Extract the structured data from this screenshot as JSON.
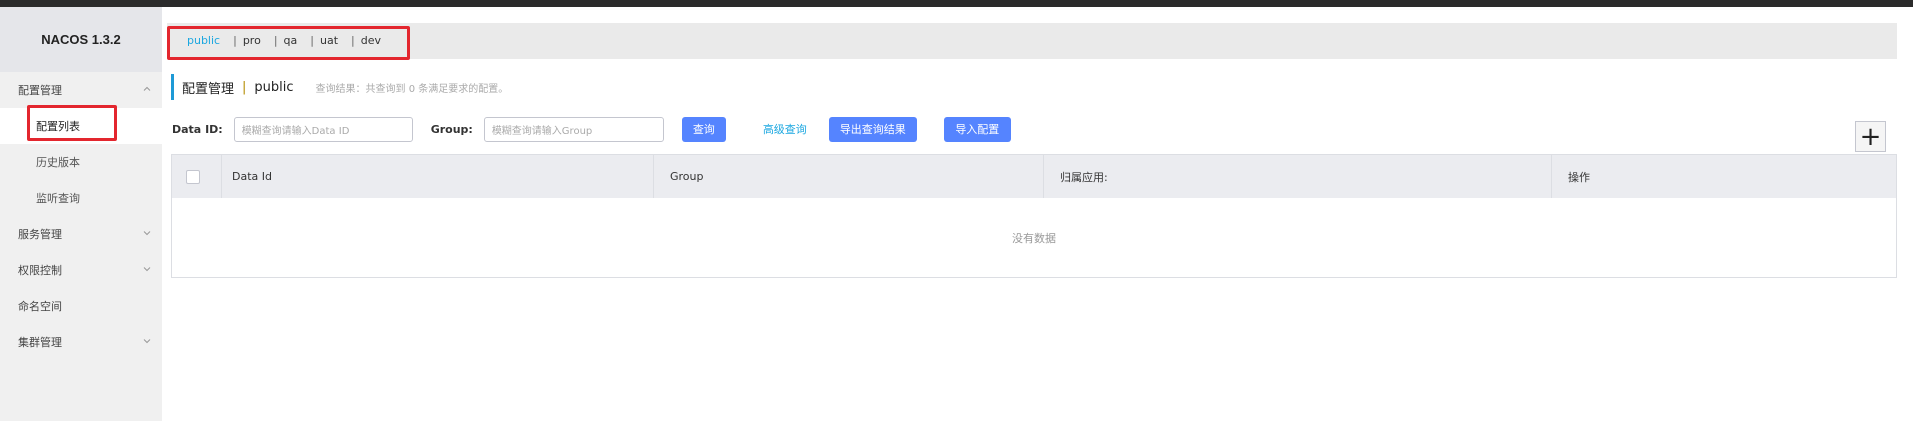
{
  "app": {
    "logo": "NACOS 1.3.2"
  },
  "sidebar": {
    "groups": [
      {
        "label": "配置管理",
        "chevron": "chevron-up-icon",
        "children": [
          "配置列表",
          "历史版本",
          "监听查询"
        ]
      },
      {
        "label": "服务管理",
        "chevron": "chevron-down-icon"
      },
      {
        "label": "权限控制",
        "chevron": "chevron-down-icon"
      },
      {
        "label": "命名空间"
      },
      {
        "label": "集群管理",
        "chevron": "chevron-down-icon"
      }
    ],
    "active_item": "配置列表"
  },
  "namespaces": {
    "items": [
      "public",
      "pro",
      "qa",
      "uat",
      "dev"
    ],
    "separator": "|",
    "active": "public"
  },
  "header": {
    "title": "配置管理",
    "separator": "|",
    "namespace": "public",
    "result_text": "查询结果：共查询到 0 条满足要求的配置。"
  },
  "search": {
    "data_id_label": "Data ID:",
    "data_id_placeholder": "模糊查询请输入Data ID",
    "group_label": "Group:",
    "group_placeholder": "模糊查询请输入Group",
    "query_button": "查询",
    "advanced_query": "高级查询",
    "export_button": "导出查询结果",
    "import_button": "导入配置"
  },
  "add_button": "+",
  "table": {
    "columns": [
      "Data Id",
      "Group",
      "归属应用:",
      "操作"
    ],
    "empty_text": "没有数据"
  },
  "colors": {
    "accent": "#1ba7e0",
    "primary_button": "#5584ff",
    "highlight_box": "#e3262e"
  }
}
